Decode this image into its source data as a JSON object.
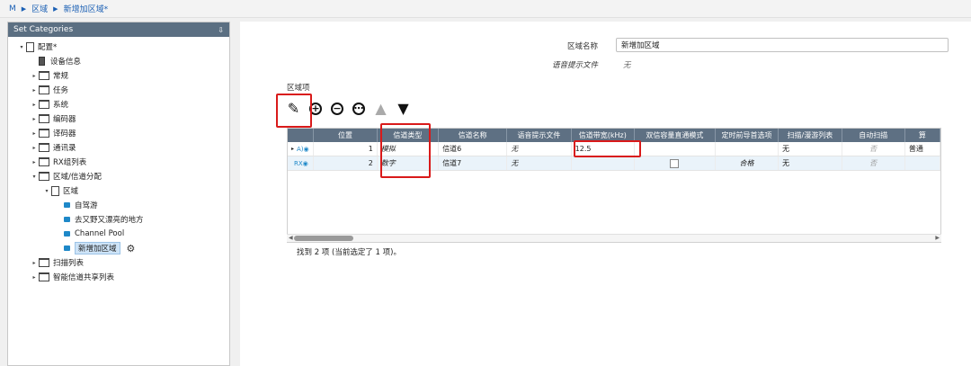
{
  "breadcrumb": [
    "M",
    "区域",
    "新增加区域*"
  ],
  "left_panel": {
    "title": "Set Categories",
    "pin": "⇩"
  },
  "tree": [
    {
      "label": "配置*",
      "depth": 0,
      "expand": "▾",
      "icon": "page"
    },
    {
      "label": "设备信息",
      "depth": 1,
      "expand": "",
      "icon": "device"
    },
    {
      "label": "常规",
      "depth": 1,
      "expand": "▸",
      "icon": "folder"
    },
    {
      "label": "任务",
      "depth": 1,
      "expand": "▸",
      "icon": "folder"
    },
    {
      "label": "系统",
      "depth": 1,
      "expand": "▸",
      "icon": "folder"
    },
    {
      "label": "编码器",
      "depth": 1,
      "expand": "▸",
      "icon": "folder"
    },
    {
      "label": "译码器",
      "depth": 1,
      "expand": "▸",
      "icon": "folder"
    },
    {
      "label": "通讯录",
      "depth": 1,
      "expand": "▸",
      "icon": "folder"
    },
    {
      "label": "RX组列表",
      "depth": 1,
      "expand": "▸",
      "icon": "folder"
    },
    {
      "label": "区域/信道分配",
      "depth": 1,
      "expand": "▾",
      "icon": "folder"
    },
    {
      "label": "区域",
      "depth": 2,
      "expand": "▾",
      "icon": "page"
    },
    {
      "label": "自驾游",
      "depth": 3,
      "expand": "",
      "icon": "blue"
    },
    {
      "label": "去又野又漂亮的地方",
      "depth": 3,
      "expand": "",
      "icon": "blue"
    },
    {
      "label": "Channel Pool",
      "depth": 3,
      "expand": "",
      "icon": "blue"
    },
    {
      "label": "新增加区域",
      "depth": 3,
      "expand": "",
      "icon": "blue",
      "selected": true
    },
    {
      "label": "扫描列表",
      "depth": 1,
      "expand": "▸",
      "icon": "folder"
    },
    {
      "label": "智能信道共享列表",
      "depth": 1,
      "expand": "▸",
      "icon": "folder"
    }
  ],
  "form": {
    "zone_name_label": "区域名称",
    "zone_name_value": "新增加区域",
    "voice_prompt_label": "语音提示文件",
    "voice_prompt_value": "无"
  },
  "section_label": "区域项",
  "toolbar": {
    "edit": "✎",
    "add": "+",
    "remove": "−",
    "more": "⋯",
    "up": "▲",
    "down": "▼"
  },
  "grid": {
    "columns": [
      "",
      "位置",
      "信道类型",
      "信道名称",
      "语音提示文件",
      "信道带宽(kHz)",
      "双信容量直通模式",
      "定时前导首选项",
      "扫描/漫游列表",
      "自动扫描",
      "算"
    ],
    "rows": [
      {
        "marker": "▸",
        "icon": "A)◉",
        "pos": "1",
        "type": "模拟",
        "name": "信道6",
        "voice": "无",
        "bandwidth": "12.5",
        "dual": "",
        "preamble": "",
        "scan": "无",
        "auto": "否",
        "extra": "普通"
      },
      {
        "marker": "",
        "icon": "RX◉",
        "pos": "2",
        "type": "数字",
        "name": "信道7",
        "voice": "无",
        "bandwidth": "",
        "dual": "checkbox",
        "preamble": "合格",
        "scan": "无",
        "auto": "否",
        "extra": ""
      }
    ]
  },
  "status": "找到 2 项 (当前选定了 1 项)。"
}
